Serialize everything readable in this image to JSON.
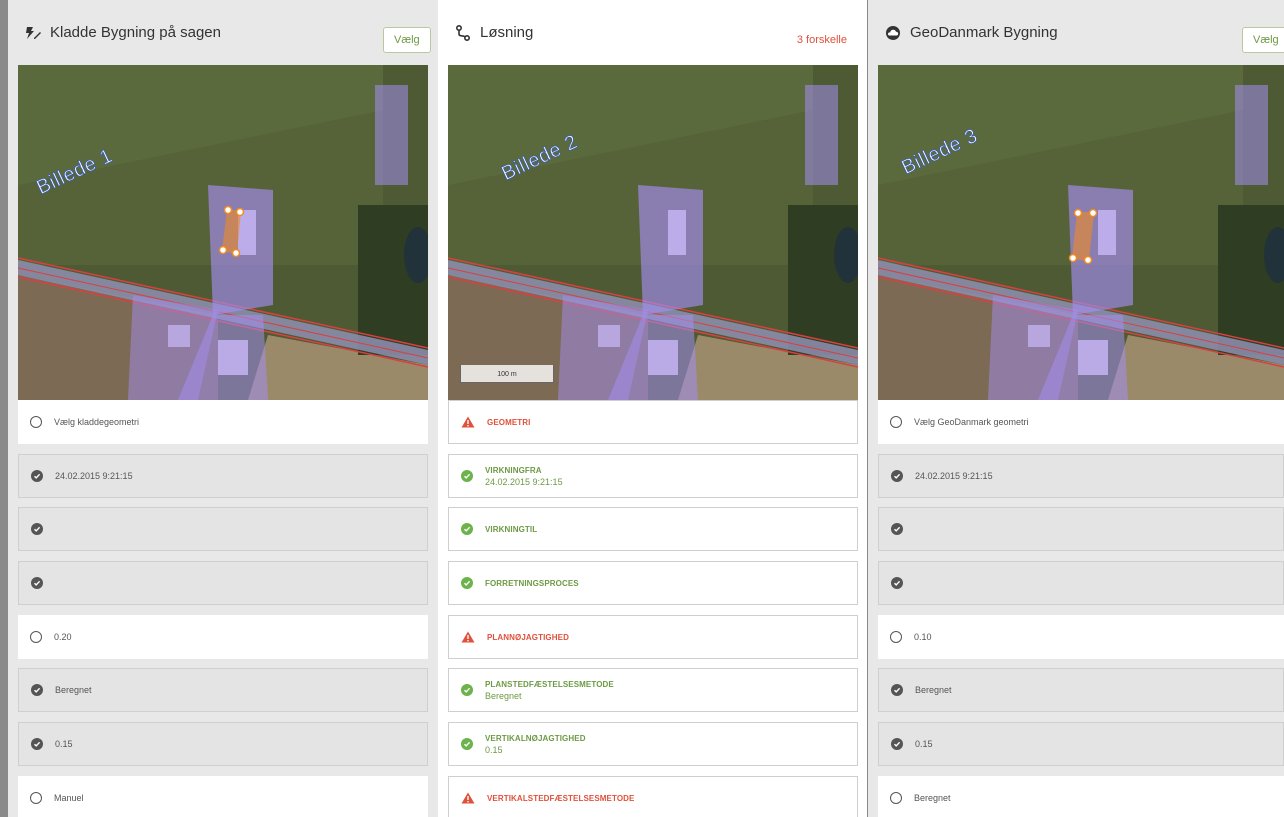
{
  "panels": [
    {
      "title": "Kladde Bygning på sagen",
      "icon": "draft-building-icon",
      "select_label": "Vælg",
      "map_label": "Billede 1",
      "rows": [
        {
          "type": "radio",
          "style": "w",
          "text": "Vælg kladdegeometri"
        },
        {
          "type": "check",
          "style": "g",
          "text": "24.02.2015 9:21:15"
        },
        {
          "type": "check",
          "style": "g",
          "text": ""
        },
        {
          "type": "check",
          "style": "g",
          "text": ""
        },
        {
          "type": "radio",
          "style": "w",
          "text": "0.20"
        },
        {
          "type": "check",
          "style": "g",
          "text": "Beregnet"
        },
        {
          "type": "check",
          "style": "g",
          "text": "0.15"
        },
        {
          "type": "radio",
          "style": "w",
          "text": "Manuel"
        }
      ]
    },
    {
      "title": "Løsning",
      "icon": "solution-route-icon",
      "diff_label": "3 forskelle",
      "map_label": "Billede 2",
      "scale_label": "100 m",
      "rows": [
        {
          "type": "warn",
          "label": "GEOMETRI",
          "value": ""
        },
        {
          "type": "ok",
          "label": "VIRKNINGFRA",
          "value": "24.02.2015 9:21:15"
        },
        {
          "type": "ok",
          "label": "VIRKNINGTIL",
          "value": ""
        },
        {
          "type": "ok",
          "label": "FORRETNINGSPROCES",
          "value": ""
        },
        {
          "type": "warn",
          "label": "PLANNØJAGTIGHED",
          "value": ""
        },
        {
          "type": "ok",
          "label": "PLANSTEDFÆSTELSESMETODE",
          "value": "Beregnet"
        },
        {
          "type": "ok",
          "label": "VERTIKALNØJAGTIGHED",
          "value": "0.15"
        },
        {
          "type": "warn",
          "label": "VERTIKALSTEDFÆSTELSESMETODE",
          "value": ""
        }
      ]
    },
    {
      "title": "GeoDanmark Bygning",
      "icon": "cloud-icon",
      "select_label": "Vælg",
      "map_label": "Billede 3",
      "rows": [
        {
          "type": "radio",
          "style": "w",
          "text": "Vælg GeoDanmark geometri"
        },
        {
          "type": "check",
          "style": "g",
          "text": "24.02.2015 9:21:15"
        },
        {
          "type": "check",
          "style": "g",
          "text": ""
        },
        {
          "type": "check",
          "style": "g",
          "text": ""
        },
        {
          "type": "radio",
          "style": "w",
          "text": "0.10"
        },
        {
          "type": "check",
          "style": "g",
          "text": "Beregnet"
        },
        {
          "type": "check",
          "style": "g",
          "text": "0.15"
        },
        {
          "type": "radio",
          "style": "w",
          "text": "Beregnet"
        }
      ]
    }
  ],
  "colors": {
    "accent_green": "#6d9a44",
    "warning_red": "#e0513c",
    "building_fill": "#a48ef0",
    "draft_outline": "#f08a24"
  }
}
